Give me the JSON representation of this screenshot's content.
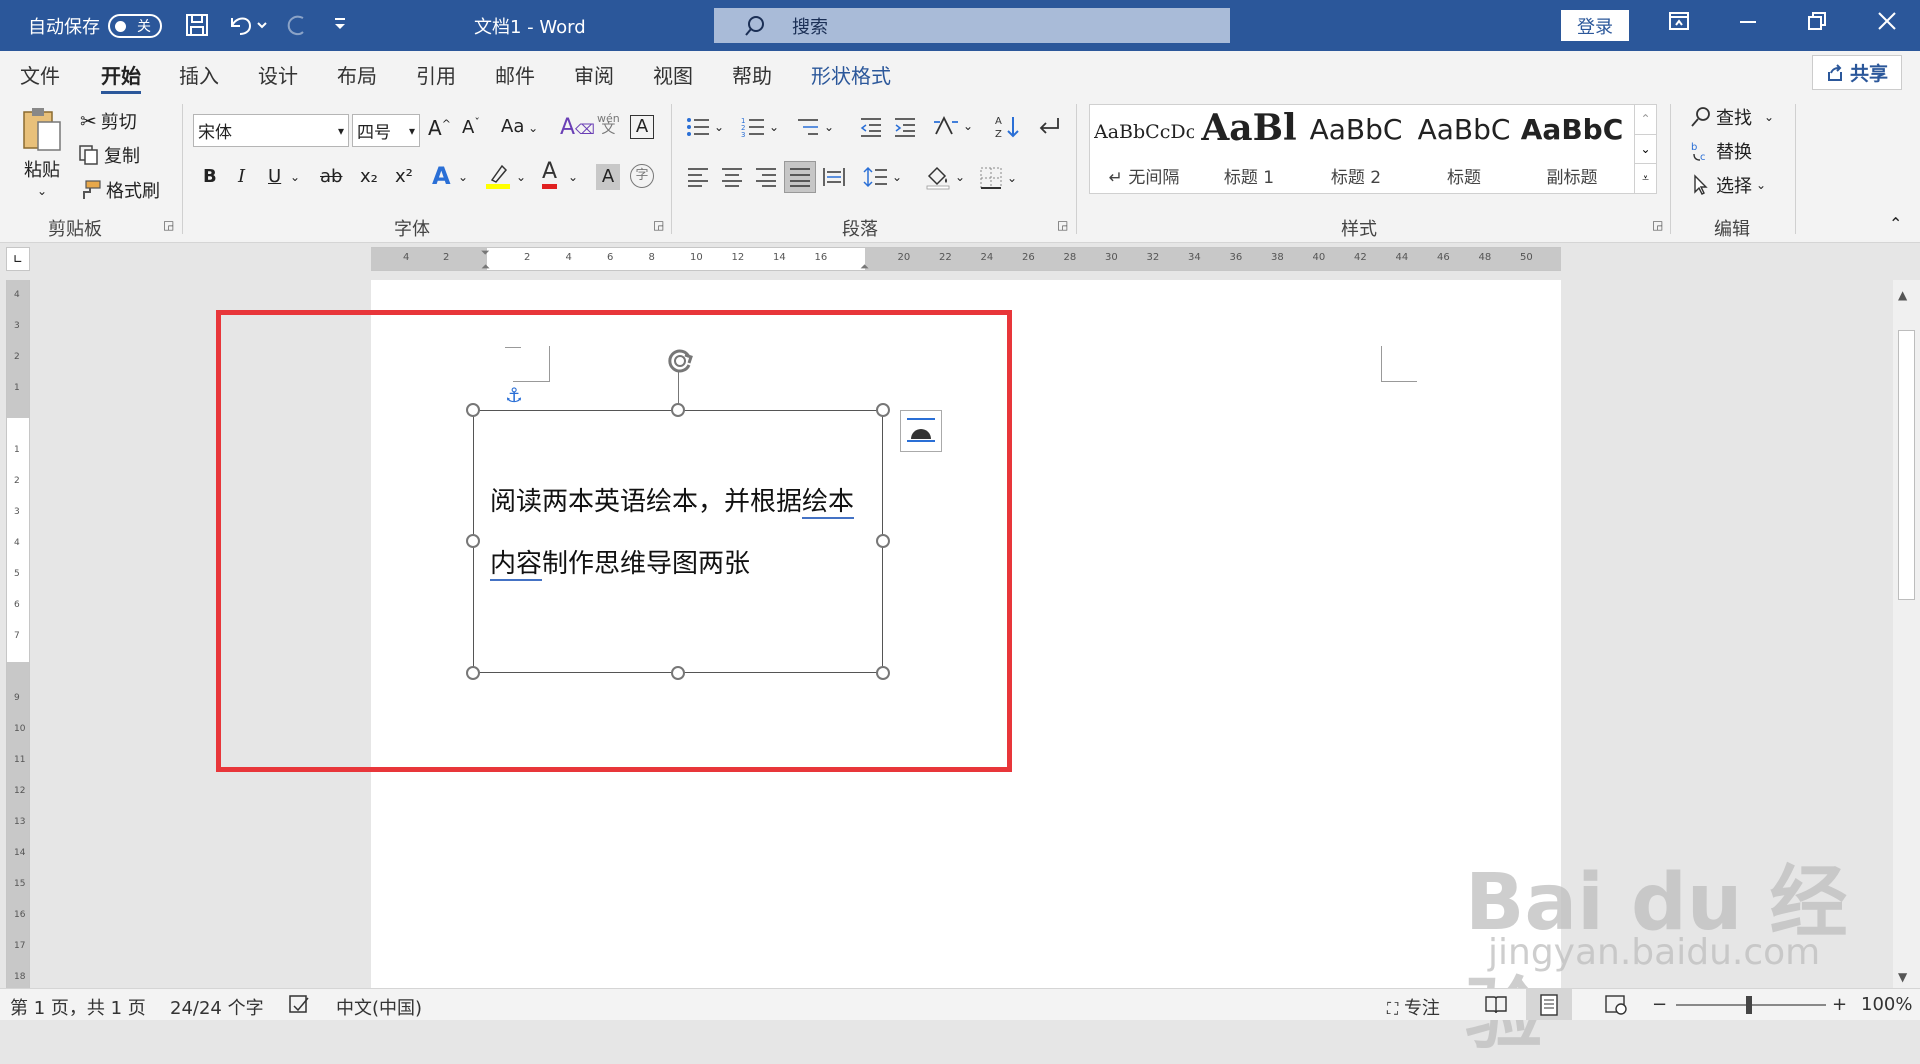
{
  "titlebar": {
    "autosave_label": "自动保存",
    "autosave_state": "关",
    "doc_title": "文档1  -  Word",
    "search_placeholder": "搜索",
    "login_label": "登录"
  },
  "menubar": {
    "tabs": [
      "文件",
      "开始",
      "插入",
      "设计",
      "布局",
      "引用",
      "邮件",
      "审阅",
      "视图",
      "帮助",
      "形状格式"
    ],
    "active_tab": "开始",
    "share_label": "共享"
  },
  "ribbon": {
    "clipboard": {
      "paste_label": "粘贴",
      "cut_label": "剪切",
      "copy_label": "复制",
      "format_painter_label": "格式刷",
      "group_label": "剪贴板"
    },
    "font": {
      "font_name": "宋体",
      "font_size": "四号",
      "change_case_label": "Aa",
      "phonetic_top": "wén",
      "phonetic_bottom": "文",
      "border_char": "A",
      "enclose_char": "字",
      "group_label": "字体",
      "bold": "B",
      "italic": "I",
      "underline": "U",
      "strike": "ab",
      "sub": "x₂",
      "sup": "x²",
      "effect": "A",
      "color_a": "A",
      "shade_a": "A"
    },
    "paragraph": {
      "group_label": "段落"
    },
    "styles": {
      "items": [
        {
          "sample": "AaBbCcDc",
          "name": "↵ 无间隔"
        },
        {
          "sample": "AaBl",
          "name": "标题 1"
        },
        {
          "sample": "AaBbC",
          "name": "标题 2"
        },
        {
          "sample": "AaBbC",
          "name": "标题"
        },
        {
          "sample": "AaBbC",
          "name": "副标题"
        }
      ],
      "group_label": "样式"
    },
    "editing": {
      "find_label": "查找",
      "replace_label": "替换",
      "select_label": "选择",
      "group_label": "编辑"
    }
  },
  "ruler": {
    "left_numbers": [
      "4",
      "2"
    ],
    "right_numbers": [
      "2",
      "4",
      "6",
      "8",
      "10",
      "12",
      "14",
      "16",
      "",
      "20",
      "22",
      "24",
      "26",
      "28",
      "30",
      "32",
      "34",
      "36",
      "38",
      "40",
      "42",
      "44",
      "46",
      "48",
      "50"
    ],
    "vertical_numbers": [
      "4",
      "3",
      "2",
      "1",
      "",
      "1",
      "2",
      "3",
      "4",
      "5",
      "6",
      "7",
      "",
      "9",
      "10",
      "11",
      "12",
      "13",
      "14",
      "15",
      "16",
      "17",
      "18"
    ]
  },
  "document": {
    "textbox_line1_plain": "阅读两本英语绘本，并根据",
    "textbox_line1_underlined": "绘本",
    "textbox_line2_underlined": "内容",
    "textbox_line2_plain": "制作思维导图两张"
  },
  "statusbar": {
    "page_info": "第 1 页，共 1 页",
    "word_count": "24/24 个字",
    "language": "中文(中国)",
    "focus_label": "专注",
    "zoom_minus": "−",
    "zoom_plus": "+",
    "zoom_level": "100%"
  },
  "watermark": {
    "brand": "Bai du 经验",
    "url": "jingyan.baidu.com"
  },
  "colors": {
    "title_bar": "#2b579a",
    "highlight_red": "#e8363a",
    "font_color": "#e02020",
    "highlight_yellow": "#ffff00"
  }
}
